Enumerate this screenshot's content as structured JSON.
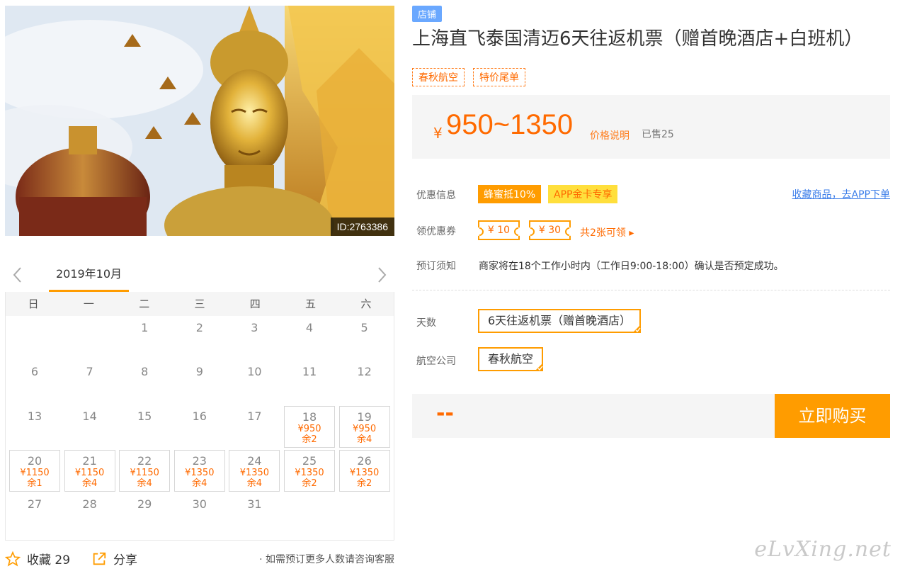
{
  "image": {
    "id_badge": "ID:2763386"
  },
  "calendar": {
    "month": "2019年10月",
    "weekdays": [
      "日",
      "一",
      "二",
      "三",
      "四",
      "五",
      "六"
    ],
    "days": [
      {
        "d": "1",
        "col": 2,
        "row": 0
      },
      {
        "d": "2",
        "col": 3,
        "row": 0
      },
      {
        "d": "3",
        "col": 4,
        "row": 0
      },
      {
        "d": "4",
        "col": 5,
        "row": 0
      },
      {
        "d": "5",
        "col": 6,
        "row": 0
      },
      {
        "d": "6",
        "col": 0,
        "row": 1
      },
      {
        "d": "7",
        "col": 1,
        "row": 1
      },
      {
        "d": "8",
        "col": 2,
        "row": 1
      },
      {
        "d": "9",
        "col": 3,
        "row": 1
      },
      {
        "d": "10",
        "col": 4,
        "row": 1
      },
      {
        "d": "11",
        "col": 5,
        "row": 1
      },
      {
        "d": "12",
        "col": 6,
        "row": 1
      },
      {
        "d": "13",
        "col": 0,
        "row": 2
      },
      {
        "d": "14",
        "col": 1,
        "row": 2
      },
      {
        "d": "15",
        "col": 2,
        "row": 2
      },
      {
        "d": "16",
        "col": 3,
        "row": 2
      },
      {
        "d": "17",
        "col": 4,
        "row": 2
      },
      {
        "d": "18",
        "col": 5,
        "row": 2,
        "price": "¥950",
        "left": "余2"
      },
      {
        "d": "19",
        "col": 6,
        "row": 2,
        "price": "¥950",
        "left": "余4"
      },
      {
        "d": "20",
        "col": 0,
        "row": 3,
        "price": "¥1150",
        "left": "余1"
      },
      {
        "d": "21",
        "col": 1,
        "row": 3,
        "price": "¥1150",
        "left": "余4"
      },
      {
        "d": "22",
        "col": 2,
        "row": 3,
        "price": "¥1150",
        "left": "余4"
      },
      {
        "d": "23",
        "col": 3,
        "row": 3,
        "price": "¥1350",
        "left": "余4"
      },
      {
        "d": "24",
        "col": 4,
        "row": 3,
        "price": "¥1350",
        "left": "余4"
      },
      {
        "d": "25",
        "col": 5,
        "row": 3,
        "price": "¥1350",
        "left": "余2"
      },
      {
        "d": "26",
        "col": 6,
        "row": 3,
        "price": "¥1350",
        "left": "余2"
      },
      {
        "d": "27",
        "col": 0,
        "row": 4
      },
      {
        "d": "28",
        "col": 1,
        "row": 4
      },
      {
        "d": "29",
        "col": 2,
        "row": 4
      },
      {
        "d": "30",
        "col": 3,
        "row": 4
      },
      {
        "d": "31",
        "col": 4,
        "row": 4
      }
    ]
  },
  "footer": {
    "favorite": "收藏 29",
    "share": "分享",
    "consult": "· 如需预订更多人数请咨询客服",
    "watermark": "eLvXing.net"
  },
  "product": {
    "shop_badge": "店铺",
    "title": "上海直飞泰国清迈6天往返机票（赠首晚酒店+白班机）",
    "tags": [
      "春秋航空",
      "特价尾单"
    ],
    "currency": "¥",
    "price_range": "950~1350",
    "price_explain": "价格说明",
    "sold": "已售25"
  },
  "info": {
    "promo_label": "优惠信息",
    "promo_a": "蜂蜜抵10%",
    "promo_b": "APP金卡专享",
    "app_link": "收藏商品，去APP下单",
    "coupon_label": "领优惠券",
    "coupons": [
      "¥ 10",
      "¥ 30"
    ],
    "coupon_all": "共2张可领 ▸",
    "notice_label": "预订须知",
    "notice": "商家将在18个工作小时内（工作日9:00-18:00）确认是否预定成功。"
  },
  "options": {
    "days_label": "天数",
    "days_value": "6天往返机票（赠首晚酒店）",
    "airline_label": "航空公司",
    "airline_value": "春秋航空"
  },
  "buy": {
    "total": "--",
    "button": "立即购买"
  },
  "colors": {
    "accent": "#ff9c00",
    "price": "#ff6a00",
    "link": "#3b7de9",
    "shop_badge": "#6aa8ff"
  }
}
